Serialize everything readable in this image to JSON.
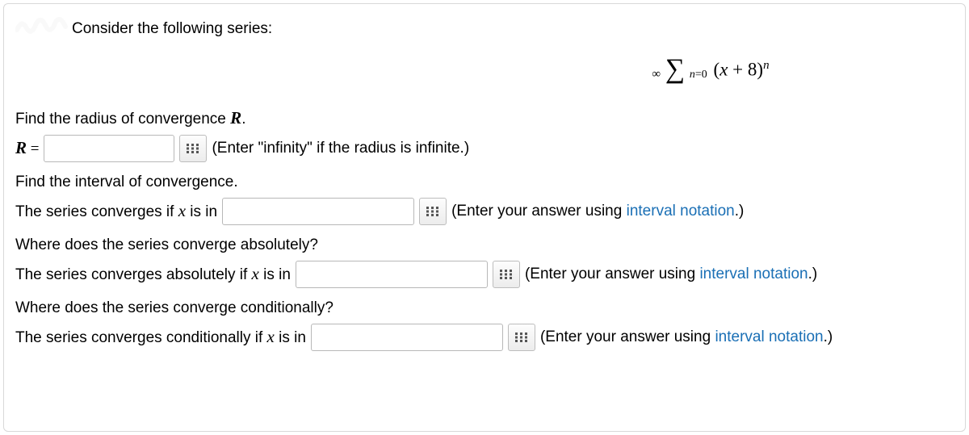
{
  "prompt": "Consider the following series:",
  "formula": {
    "upper": "∞",
    "lower_var": "n",
    "lower_eq": "=0",
    "base_open": "(",
    "base_var": "x",
    "base_plus": " + 8)",
    "exp": "n"
  },
  "q1": {
    "heading": "Find the radius of convergence ",
    "heading_var": "R",
    "heading_end": ".",
    "label_var": "R",
    "label_eq": " =",
    "hint": "(Enter \"infinity\" if the radius is infinite.)"
  },
  "q2": {
    "heading": "Find the interval of convergence.",
    "label_pre": "The series converges if ",
    "label_var": "x",
    "label_post": " is in",
    "hint_pre": "(Enter your answer using ",
    "hint_link": "interval notation",
    "hint_post": ".)"
  },
  "q3": {
    "heading": "Where does the series converge absolutely?",
    "label_pre": "The series converges absolutely if ",
    "label_var": "x",
    "label_post": " is in",
    "hint_pre": "(Enter your answer using ",
    "hint_link": "interval notation",
    "hint_post": ".)"
  },
  "q4": {
    "heading": "Where does the series converge conditionally?",
    "label_pre": "The series converges conditionally if ",
    "label_var": "x",
    "label_post": " is in",
    "hint_pre": "(Enter your answer using ",
    "hint_link": "interval notation",
    "hint_post": ".)"
  }
}
